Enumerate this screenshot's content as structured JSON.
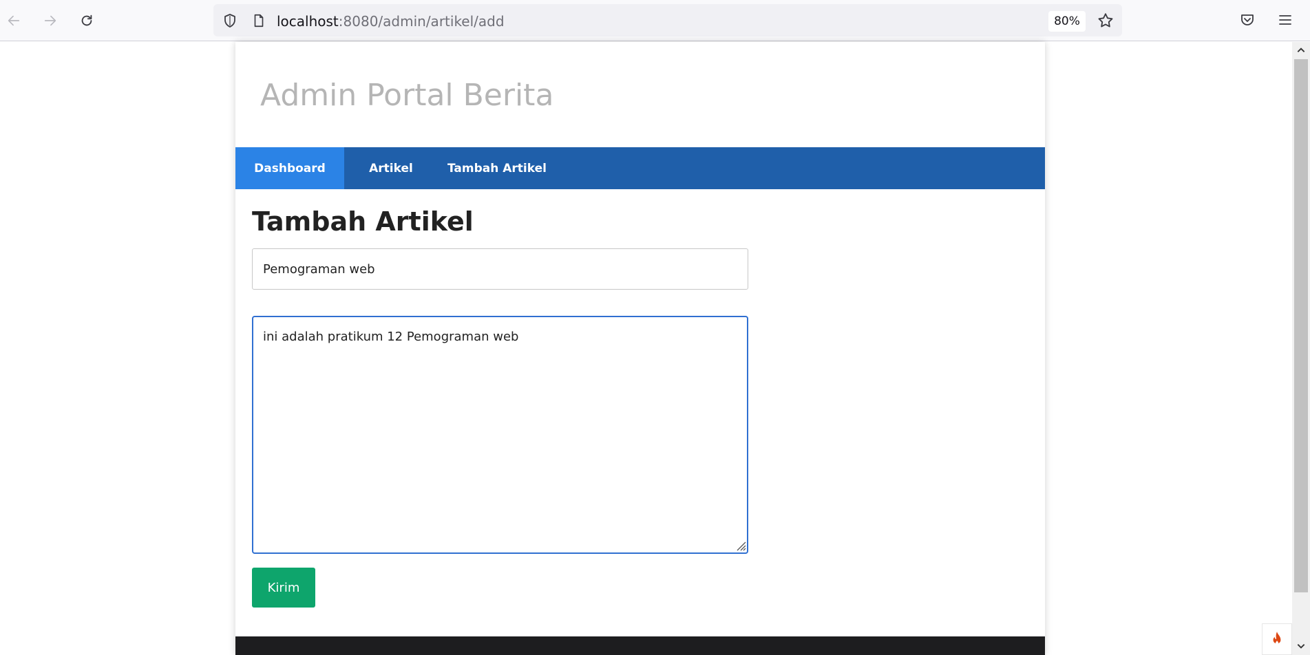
{
  "browser": {
    "url_host": "localhost",
    "url_path": ":8080/admin/artikel/add",
    "zoom": "80%"
  },
  "icons": {
    "back": "back-arrow-icon",
    "forward": "forward-arrow-icon",
    "reload": "reload-icon",
    "shield": "shield-icon",
    "page": "page-icon",
    "bookmark": "star-icon",
    "pocket": "pocket-icon",
    "menu": "hamburger-menu-icon",
    "codeigniter": "flame-icon"
  },
  "header": {
    "title": "Admin Portal Berita"
  },
  "nav": {
    "items": [
      {
        "label": "Dashboard",
        "active": true
      },
      {
        "label": "Artikel",
        "active": false
      },
      {
        "label": "Tambah Artikel",
        "active": false
      }
    ]
  },
  "form": {
    "heading": "Tambah Artikel",
    "title_value": "Pemograman web",
    "body_value": "ini adalah pratikum 12 Pemograman web",
    "submit_label": "Kirim"
  },
  "colors": {
    "nav_bg": "#1f5faa",
    "nav_active": "#2b83e6",
    "submit_bg": "#0ea56c",
    "textarea_focus": "#2f6fd1"
  }
}
